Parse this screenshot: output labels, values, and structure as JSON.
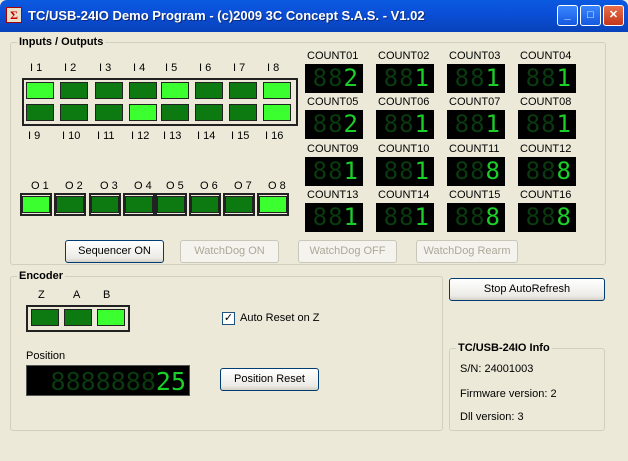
{
  "window": {
    "title": "TC/USB-24IO Demo Program - (c)2009 3C Concept S.A.S. - V1.02",
    "icon": "app-logo-icon",
    "min": "_",
    "max": "□",
    "close": "✕"
  },
  "io": {
    "title": "Inputs / Outputs",
    "inputs_top": [
      "I 1",
      "I 2",
      "I 3",
      "I 4",
      "I 5",
      "I 6",
      "I 7",
      "I 8"
    ],
    "inputs_bottom": [
      "I 9",
      "I 10",
      "I 11",
      "I 12",
      "I 13",
      "I 14",
      "I 15",
      "I 16"
    ],
    "inputs_states_top": [
      true,
      false,
      false,
      false,
      true,
      false,
      false,
      true
    ],
    "inputs_states_bottom": [
      false,
      false,
      false,
      true,
      false,
      false,
      false,
      true
    ],
    "outputs": [
      "O 1",
      "O 2",
      "O 3",
      "O 4",
      "O 5",
      "O 6",
      "O 7",
      "O 8"
    ],
    "outputs_states": [
      true,
      false,
      false,
      false,
      false,
      false,
      false,
      true
    ]
  },
  "counters": [
    {
      "label": "COUNT01",
      "value": "2"
    },
    {
      "label": "COUNT02",
      "value": "1"
    },
    {
      "label": "COUNT03",
      "value": "1"
    },
    {
      "label": "COUNT04",
      "value": "1"
    },
    {
      "label": "COUNT05",
      "value": "2"
    },
    {
      "label": "COUNT06",
      "value": "1"
    },
    {
      "label": "COUNT07",
      "value": "1"
    },
    {
      "label": "COUNT08",
      "value": "1"
    },
    {
      "label": "COUNT09",
      "value": "1"
    },
    {
      "label": "COUNT10",
      "value": "1"
    },
    {
      "label": "COUNT11",
      "value": "8"
    },
    {
      "label": "COUNT12",
      "value": "8"
    },
    {
      "label": "COUNT13",
      "value": "1"
    },
    {
      "label": "COUNT14",
      "value": "1"
    },
    {
      "label": "COUNT15",
      "value": "8"
    },
    {
      "label": "COUNT16",
      "value": "8"
    }
  ],
  "buttons": {
    "sequencer": "Sequencer ON",
    "watchdog_on": "WatchDog ON",
    "watchdog_off": "WatchDog OFF",
    "watchdog_rearm": "WatchDog Rearm",
    "stop_refresh": "Stop AutoRefresh",
    "position_reset": "Position Reset"
  },
  "encoder": {
    "title": "Encoder",
    "labels": [
      "Z",
      "A",
      "B"
    ],
    "states": [
      false,
      false,
      true
    ],
    "autoreset_label": "Auto Reset on Z",
    "autoreset_checked": true,
    "position_label": "Position",
    "position_value": "25"
  },
  "info": {
    "title": "TC/USB-24IO Info",
    "sn": "S/N: 24001003",
    "firmware": "Firmware version: 2",
    "dll": "Dll version: 3"
  }
}
